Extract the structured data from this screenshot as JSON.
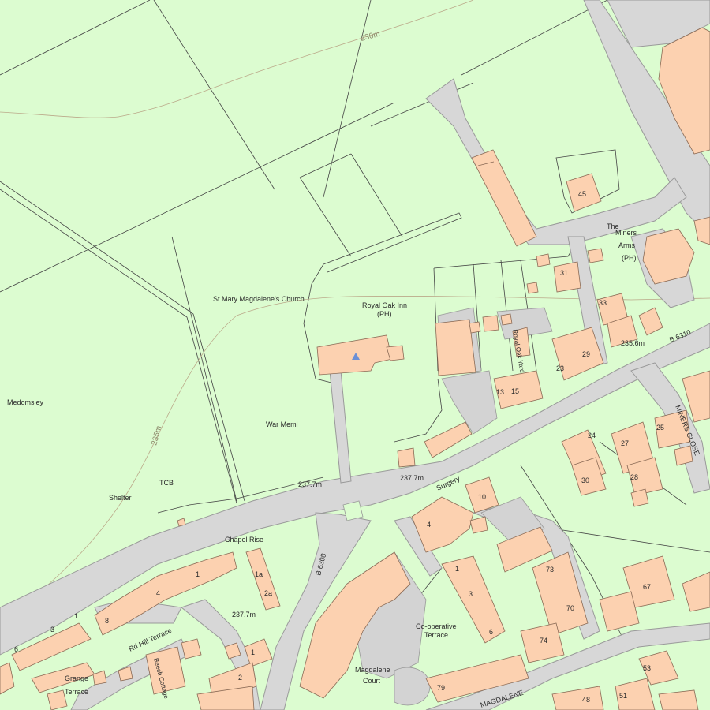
{
  "map": {
    "colors": {
      "land": "#dcfcd0",
      "road": "#d7d7d7",
      "building": "#fcd1b0",
      "contour": "#bba98a",
      "church_marker": "#6a8fd6"
    },
    "contours": {
      "c230": "230m",
      "c235": "235m"
    },
    "labels": {
      "medomsley": "Medomsley",
      "church": "St Mary Magdalene's Church",
      "royal_oak_1": "Royal Oak Inn",
      "royal_oak_2": "(PH)",
      "war_meml": "War Meml",
      "tcb": "TCB",
      "shelter": "Shelter",
      "chapel_rise": "Chapel Rise",
      "surgery": "Surgery",
      "miners_1": "The",
      "miners_2": "Miners",
      "miners_3": "Arms",
      "miners_4": "(PH)",
      "royal_oak_yard": "Royal Oak Yard",
      "coop_1": "Co-operative",
      "coop_2": "Terrace",
      "magdalene_1": "Magdalene",
      "magdalene_2": "Court",
      "grange_1": "Grange",
      "grange_2": "Terrace",
      "beech": "Beech Cottage",
      "roman_terrace": "Rd Hill Terrace",
      "miners_close": "MINERS CLOSE",
      "magdalene_st": "MAGDALENE",
      "road_b6308": "B 6308",
      "road_b6310": "B 6310"
    },
    "spot_heights": {
      "h1": "237.7m",
      "h2": "237.7m",
      "h3": "237.7m",
      "h4": "235.6m"
    },
    "house_numbers": {
      "n45": "45",
      "n31": "31",
      "n33": "33",
      "n23": "23",
      "n29": "29",
      "n13": "13",
      "n15": "15",
      "n10": "10",
      "n4a": "4",
      "n1a": "1a",
      "n2a": "2a",
      "n1b": "1",
      "n3b": "3",
      "n6b": "6",
      "n73": "73",
      "n70": "70",
      "n74": "74",
      "n79": "79",
      "n67": "67",
      "n24": "24",
      "n25": "25",
      "n27": "27",
      "n28": "28",
      "n30": "30",
      "n53": "53",
      "n51": "51",
      "n48": "48",
      "n8": "8",
      "n4c": "4",
      "n1c": "1",
      "n3c": "3",
      "n1d": "1",
      "n6d": "6",
      "n1e": "1",
      "n2e": "2"
    }
  }
}
